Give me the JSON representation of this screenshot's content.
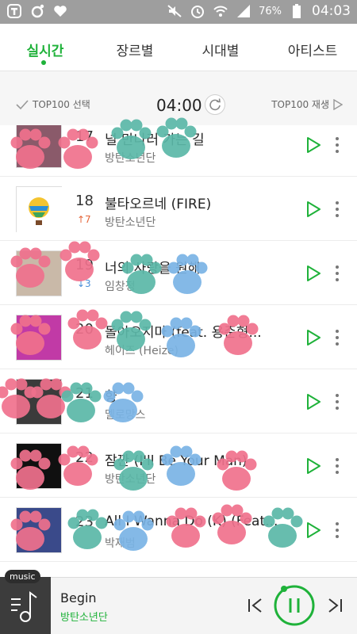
{
  "status_bar": {
    "battery": "76%",
    "time": "04:03",
    "left_icons": [
      "t-app-icon",
      "camera-app-icon",
      "heart-app-icon"
    ],
    "right_icons": [
      "mute-icon",
      "alarm-icon",
      "wifi-icon",
      "signal-icon",
      "battery-icon"
    ]
  },
  "tabs": [
    {
      "label": "실시간",
      "active": true
    },
    {
      "label": "장르별",
      "active": false
    },
    {
      "label": "시대별",
      "active": false
    },
    {
      "label": "아티스트",
      "active": false
    }
  ],
  "controls": {
    "select_label": "TOP100 선택",
    "time": "04:00",
    "play_label": "TOP100 재생"
  },
  "songs": [
    {
      "rank": "17",
      "change": "",
      "title": "널 만나러 가는 길",
      "artist": "방탄소년단",
      "art_color": "#8a5a6a"
    },
    {
      "rank": "18",
      "change": "↑7",
      "title": "불타오르네 (FIRE)",
      "artist": "방탄소년단",
      "art_color": "#ffffff"
    },
    {
      "rank": "19",
      "change": "↓3",
      "title": "너의 사랑을 원해",
      "artist": "임창정",
      "art_color": "#c9b9a8"
    },
    {
      "rank": "20",
      "change": "",
      "title": "돌아오지마 (feat. 용준형...",
      "artist": "헤이즈 (Heize)",
      "art_color": "#c13aa6"
    },
    {
      "rank": "21",
      "change": "",
      "title": "향",
      "artist": "멜로망스",
      "art_color": "#3b3b3b"
    },
    {
      "rank": "22",
      "change": "",
      "title": "잠깐 (I'll Be Your Man)",
      "artist": "방탄소년단",
      "art_color": "#101010"
    },
    {
      "rank": "23",
      "change": "",
      "title": "All I Wanna Do (K) (Feat...",
      "artist": "박재범",
      "art_color": "#3a4a8a"
    }
  ],
  "player": {
    "badge": "music",
    "title": "Begin",
    "artist": "방탄소년단"
  },
  "colors": {
    "accent": "#1fb23a",
    "up": "#e5663a",
    "down": "#4a8fd8"
  }
}
